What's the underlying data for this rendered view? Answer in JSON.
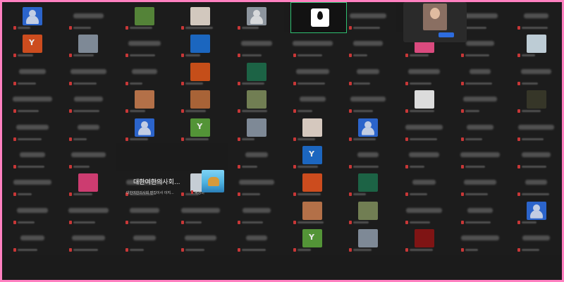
{
  "window": {
    "frame_color": "#ff80c0",
    "background": "#1b1b1b"
  },
  "active_speaker": {
    "label": "",
    "logo": "droplet-icon",
    "border_color": "#2fbf71"
  },
  "self_view": {
    "button_label": "",
    "caption": ""
  },
  "highlighted_participant": {
    "name": "대한여한의사회...",
    "subtitle": "대한여한의사회 편집이사 이지...",
    "secondary": "박경미"
  },
  "grid": {
    "columns": 10,
    "rows": 10,
    "tiles": [
      {
        "thumb": "#2d6cdf",
        "kind": "silhouette"
      },
      {
        "thumb": "",
        "kind": "name"
      },
      {
        "thumb": "#5b8f3c",
        "kind": "photo"
      },
      {
        "thumb": "#e7dbd0",
        "kind": "photo"
      },
      {
        "thumb": "#9aa3ad",
        "kind": "silhouette"
      },
      {
        "thumb": "",
        "kind": "active"
      },
      {
        "thumb": "",
        "kind": "name"
      },
      {
        "thumb": "",
        "kind": "self"
      },
      {
        "thumb": "",
        "kind": "name"
      },
      {
        "thumb": "",
        "kind": "name"
      },
      {
        "thumb": "#e0521f",
        "kind": "letter"
      },
      {
        "thumb": "#8a96a4",
        "kind": "photo"
      },
      {
        "thumb": "",
        "kind": "name"
      },
      {
        "thumb": "#1c6fd1",
        "kind": "photo"
      },
      {
        "thumb": "",
        "kind": "name"
      },
      {
        "thumb": "",
        "kind": "name"
      },
      {
        "thumb": "",
        "kind": "name"
      },
      {
        "thumb": "#f0508a",
        "kind": "photo"
      },
      {
        "thumb": "",
        "kind": "name"
      },
      {
        "thumb": "#cfe0ea",
        "kind": "photo"
      },
      {
        "thumb": "",
        "kind": "name"
      },
      {
        "thumb": "",
        "kind": "name"
      },
      {
        "thumb": "",
        "kind": "name"
      },
      {
        "thumb": "#d8541a",
        "kind": "photo"
      },
      {
        "thumb": "#1d6b4a",
        "kind": "photo"
      },
      {
        "thumb": "",
        "kind": "name"
      },
      {
        "thumb": "",
        "kind": "name"
      },
      {
        "thumb": "",
        "kind": "name"
      },
      {
        "thumb": "",
        "kind": "name"
      },
      {
        "thumb": "",
        "kind": "name"
      },
      {
        "thumb": "",
        "kind": "name"
      },
      {
        "thumb": "",
        "kind": "name"
      },
      {
        "thumb": "#c47a4e",
        "kind": "photo"
      },
      {
        "thumb": "#b86b3b",
        "kind": "photo"
      },
      {
        "thumb": "#7b8a5a",
        "kind": "photo"
      },
      {
        "thumb": "",
        "kind": "name"
      },
      {
        "thumb": "",
        "kind": "name"
      },
      {
        "thumb": "#f2f2f2",
        "kind": "photo"
      },
      {
        "thumb": "",
        "kind": "name"
      },
      {
        "thumb": "#3a3a2a",
        "kind": "photo"
      },
      {
        "thumb": "",
        "kind": "name"
      },
      {
        "thumb": "",
        "kind": "name"
      },
      {
        "thumb": "#2d6cdf",
        "kind": "silhouette"
      },
      {
        "thumb": "#5aa23a",
        "kind": "letter"
      },
      {
        "thumb": "#8a96a4",
        "kind": "photo"
      },
      {
        "thumb": "#eadcd0",
        "kind": "photo"
      },
      {
        "thumb": "#2d6cdf",
        "kind": "silhouette"
      },
      {
        "thumb": "",
        "kind": "name"
      },
      {
        "thumb": "",
        "kind": "name"
      },
      {
        "thumb": "",
        "kind": "name"
      },
      {
        "thumb": "",
        "kind": "name"
      },
      {
        "thumb": "",
        "kind": "name"
      },
      {
        "thumb": "",
        "kind": "highlight"
      },
      {
        "thumb": "",
        "kind": "highlight"
      },
      {
        "thumb": "",
        "kind": "name"
      },
      {
        "thumb": "#1c6fd1",
        "kind": "letter"
      },
      {
        "thumb": "",
        "kind": "name"
      },
      {
        "thumb": "",
        "kind": "name"
      },
      {
        "thumb": "",
        "kind": "name"
      },
      {
        "thumb": "",
        "kind": "name"
      },
      {
        "thumb": "",
        "kind": "name"
      },
      {
        "thumb": "#e0407a",
        "kind": "photo"
      },
      {
        "thumb": "",
        "kind": "name"
      },
      {
        "thumb": "#d9e2ea",
        "kind": "photo"
      },
      {
        "thumb": "",
        "kind": "name"
      },
      {
        "thumb": "#e0521f",
        "kind": "photo"
      },
      {
        "thumb": "#1d6b4a",
        "kind": "photo"
      },
      {
        "thumb": "",
        "kind": "name"
      },
      {
        "thumb": "",
        "kind": "name"
      },
      {
        "thumb": "",
        "kind": "name"
      },
      {
        "thumb": "",
        "kind": "name"
      },
      {
        "thumb": "",
        "kind": "name"
      },
      {
        "thumb": "",
        "kind": "name"
      },
      {
        "thumb": "",
        "kind": "name"
      },
      {
        "thumb": "",
        "kind": "name"
      },
      {
        "thumb": "#c47a4e",
        "kind": "photo"
      },
      {
        "thumb": "#7b8a5a",
        "kind": "photo"
      },
      {
        "thumb": "",
        "kind": "name"
      },
      {
        "thumb": "",
        "kind": "name"
      },
      {
        "thumb": "#2d6cdf",
        "kind": "silhouette"
      },
      {
        "thumb": "",
        "kind": "name"
      },
      {
        "thumb": "",
        "kind": "name"
      },
      {
        "thumb": "",
        "kind": "name"
      },
      {
        "thumb": "",
        "kind": "name"
      },
      {
        "thumb": "",
        "kind": "name"
      },
      {
        "thumb": "#5aa23a",
        "kind": "letter"
      },
      {
        "thumb": "#8a96a4",
        "kind": "photo"
      },
      {
        "thumb": "#8b1414",
        "kind": "photo"
      },
      {
        "thumb": "",
        "kind": "name"
      },
      {
        "thumb": "",
        "kind": "name"
      }
    ]
  }
}
